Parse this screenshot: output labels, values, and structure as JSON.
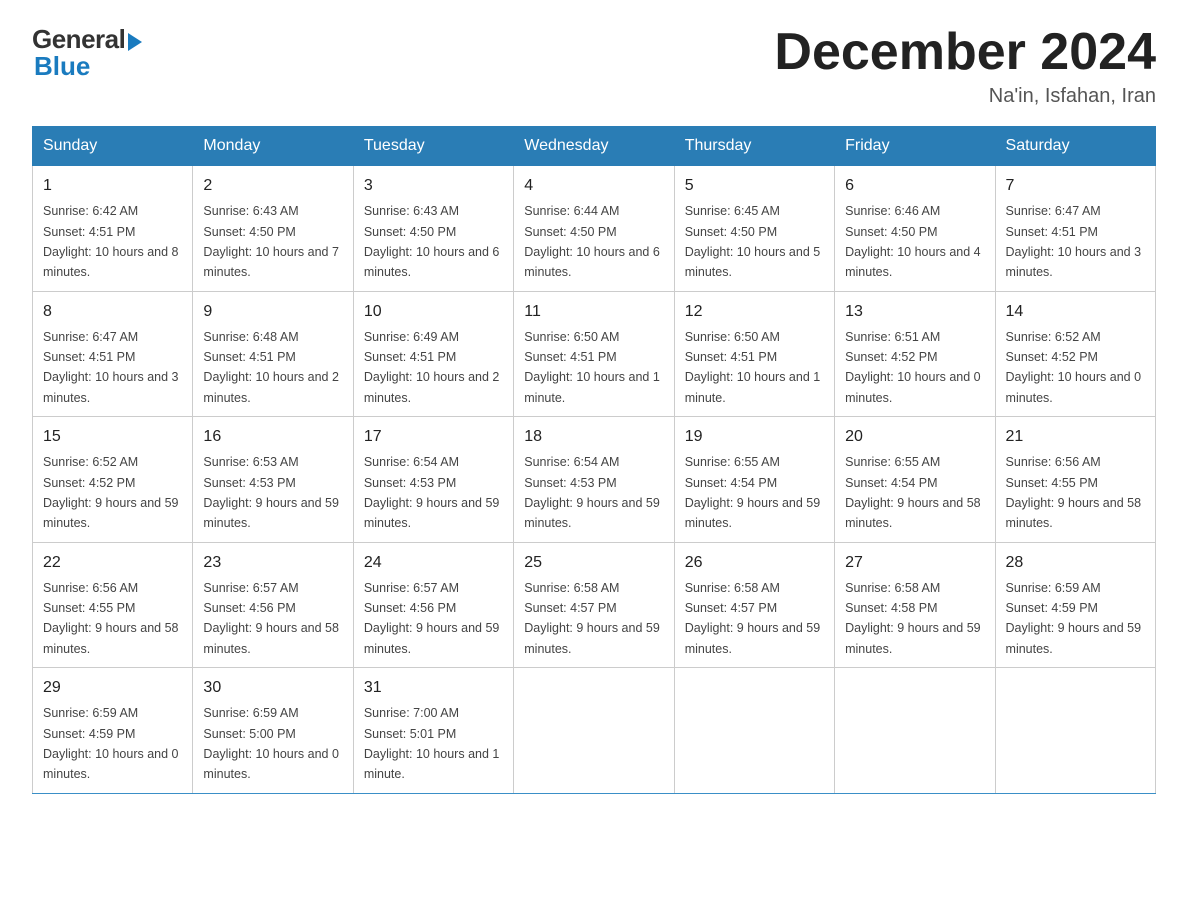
{
  "header": {
    "logo_general": "General",
    "logo_blue": "Blue",
    "title": "December 2024",
    "location": "Na'in, Isfahan, Iran"
  },
  "days_of_week": [
    "Sunday",
    "Monday",
    "Tuesday",
    "Wednesday",
    "Thursday",
    "Friday",
    "Saturday"
  ],
  "weeks": [
    [
      {
        "day": "1",
        "sunrise": "6:42 AM",
        "sunset": "4:51 PM",
        "daylight": "10 hours and 8 minutes."
      },
      {
        "day": "2",
        "sunrise": "6:43 AM",
        "sunset": "4:50 PM",
        "daylight": "10 hours and 7 minutes."
      },
      {
        "day": "3",
        "sunrise": "6:43 AM",
        "sunset": "4:50 PM",
        "daylight": "10 hours and 6 minutes."
      },
      {
        "day": "4",
        "sunrise": "6:44 AM",
        "sunset": "4:50 PM",
        "daylight": "10 hours and 6 minutes."
      },
      {
        "day": "5",
        "sunrise": "6:45 AM",
        "sunset": "4:50 PM",
        "daylight": "10 hours and 5 minutes."
      },
      {
        "day": "6",
        "sunrise": "6:46 AM",
        "sunset": "4:50 PM",
        "daylight": "10 hours and 4 minutes."
      },
      {
        "day": "7",
        "sunrise": "6:47 AM",
        "sunset": "4:51 PM",
        "daylight": "10 hours and 3 minutes."
      }
    ],
    [
      {
        "day": "8",
        "sunrise": "6:47 AM",
        "sunset": "4:51 PM",
        "daylight": "10 hours and 3 minutes."
      },
      {
        "day": "9",
        "sunrise": "6:48 AM",
        "sunset": "4:51 PM",
        "daylight": "10 hours and 2 minutes."
      },
      {
        "day": "10",
        "sunrise": "6:49 AM",
        "sunset": "4:51 PM",
        "daylight": "10 hours and 2 minutes."
      },
      {
        "day": "11",
        "sunrise": "6:50 AM",
        "sunset": "4:51 PM",
        "daylight": "10 hours and 1 minute."
      },
      {
        "day": "12",
        "sunrise": "6:50 AM",
        "sunset": "4:51 PM",
        "daylight": "10 hours and 1 minute."
      },
      {
        "day": "13",
        "sunrise": "6:51 AM",
        "sunset": "4:52 PM",
        "daylight": "10 hours and 0 minutes."
      },
      {
        "day": "14",
        "sunrise": "6:52 AM",
        "sunset": "4:52 PM",
        "daylight": "10 hours and 0 minutes."
      }
    ],
    [
      {
        "day": "15",
        "sunrise": "6:52 AM",
        "sunset": "4:52 PM",
        "daylight": "9 hours and 59 minutes."
      },
      {
        "day": "16",
        "sunrise": "6:53 AM",
        "sunset": "4:53 PM",
        "daylight": "9 hours and 59 minutes."
      },
      {
        "day": "17",
        "sunrise": "6:54 AM",
        "sunset": "4:53 PM",
        "daylight": "9 hours and 59 minutes."
      },
      {
        "day": "18",
        "sunrise": "6:54 AM",
        "sunset": "4:53 PM",
        "daylight": "9 hours and 59 minutes."
      },
      {
        "day": "19",
        "sunrise": "6:55 AM",
        "sunset": "4:54 PM",
        "daylight": "9 hours and 59 minutes."
      },
      {
        "day": "20",
        "sunrise": "6:55 AM",
        "sunset": "4:54 PM",
        "daylight": "9 hours and 58 minutes."
      },
      {
        "day": "21",
        "sunrise": "6:56 AM",
        "sunset": "4:55 PM",
        "daylight": "9 hours and 58 minutes."
      }
    ],
    [
      {
        "day": "22",
        "sunrise": "6:56 AM",
        "sunset": "4:55 PM",
        "daylight": "9 hours and 58 minutes."
      },
      {
        "day": "23",
        "sunrise": "6:57 AM",
        "sunset": "4:56 PM",
        "daylight": "9 hours and 58 minutes."
      },
      {
        "day": "24",
        "sunrise": "6:57 AM",
        "sunset": "4:56 PM",
        "daylight": "9 hours and 59 minutes."
      },
      {
        "day": "25",
        "sunrise": "6:58 AM",
        "sunset": "4:57 PM",
        "daylight": "9 hours and 59 minutes."
      },
      {
        "day": "26",
        "sunrise": "6:58 AM",
        "sunset": "4:57 PM",
        "daylight": "9 hours and 59 minutes."
      },
      {
        "day": "27",
        "sunrise": "6:58 AM",
        "sunset": "4:58 PM",
        "daylight": "9 hours and 59 minutes."
      },
      {
        "day": "28",
        "sunrise": "6:59 AM",
        "sunset": "4:59 PM",
        "daylight": "9 hours and 59 minutes."
      }
    ],
    [
      {
        "day": "29",
        "sunrise": "6:59 AM",
        "sunset": "4:59 PM",
        "daylight": "10 hours and 0 minutes."
      },
      {
        "day": "30",
        "sunrise": "6:59 AM",
        "sunset": "5:00 PM",
        "daylight": "10 hours and 0 minutes."
      },
      {
        "day": "31",
        "sunrise": "7:00 AM",
        "sunset": "5:01 PM",
        "daylight": "10 hours and 1 minute."
      },
      null,
      null,
      null,
      null
    ]
  ]
}
